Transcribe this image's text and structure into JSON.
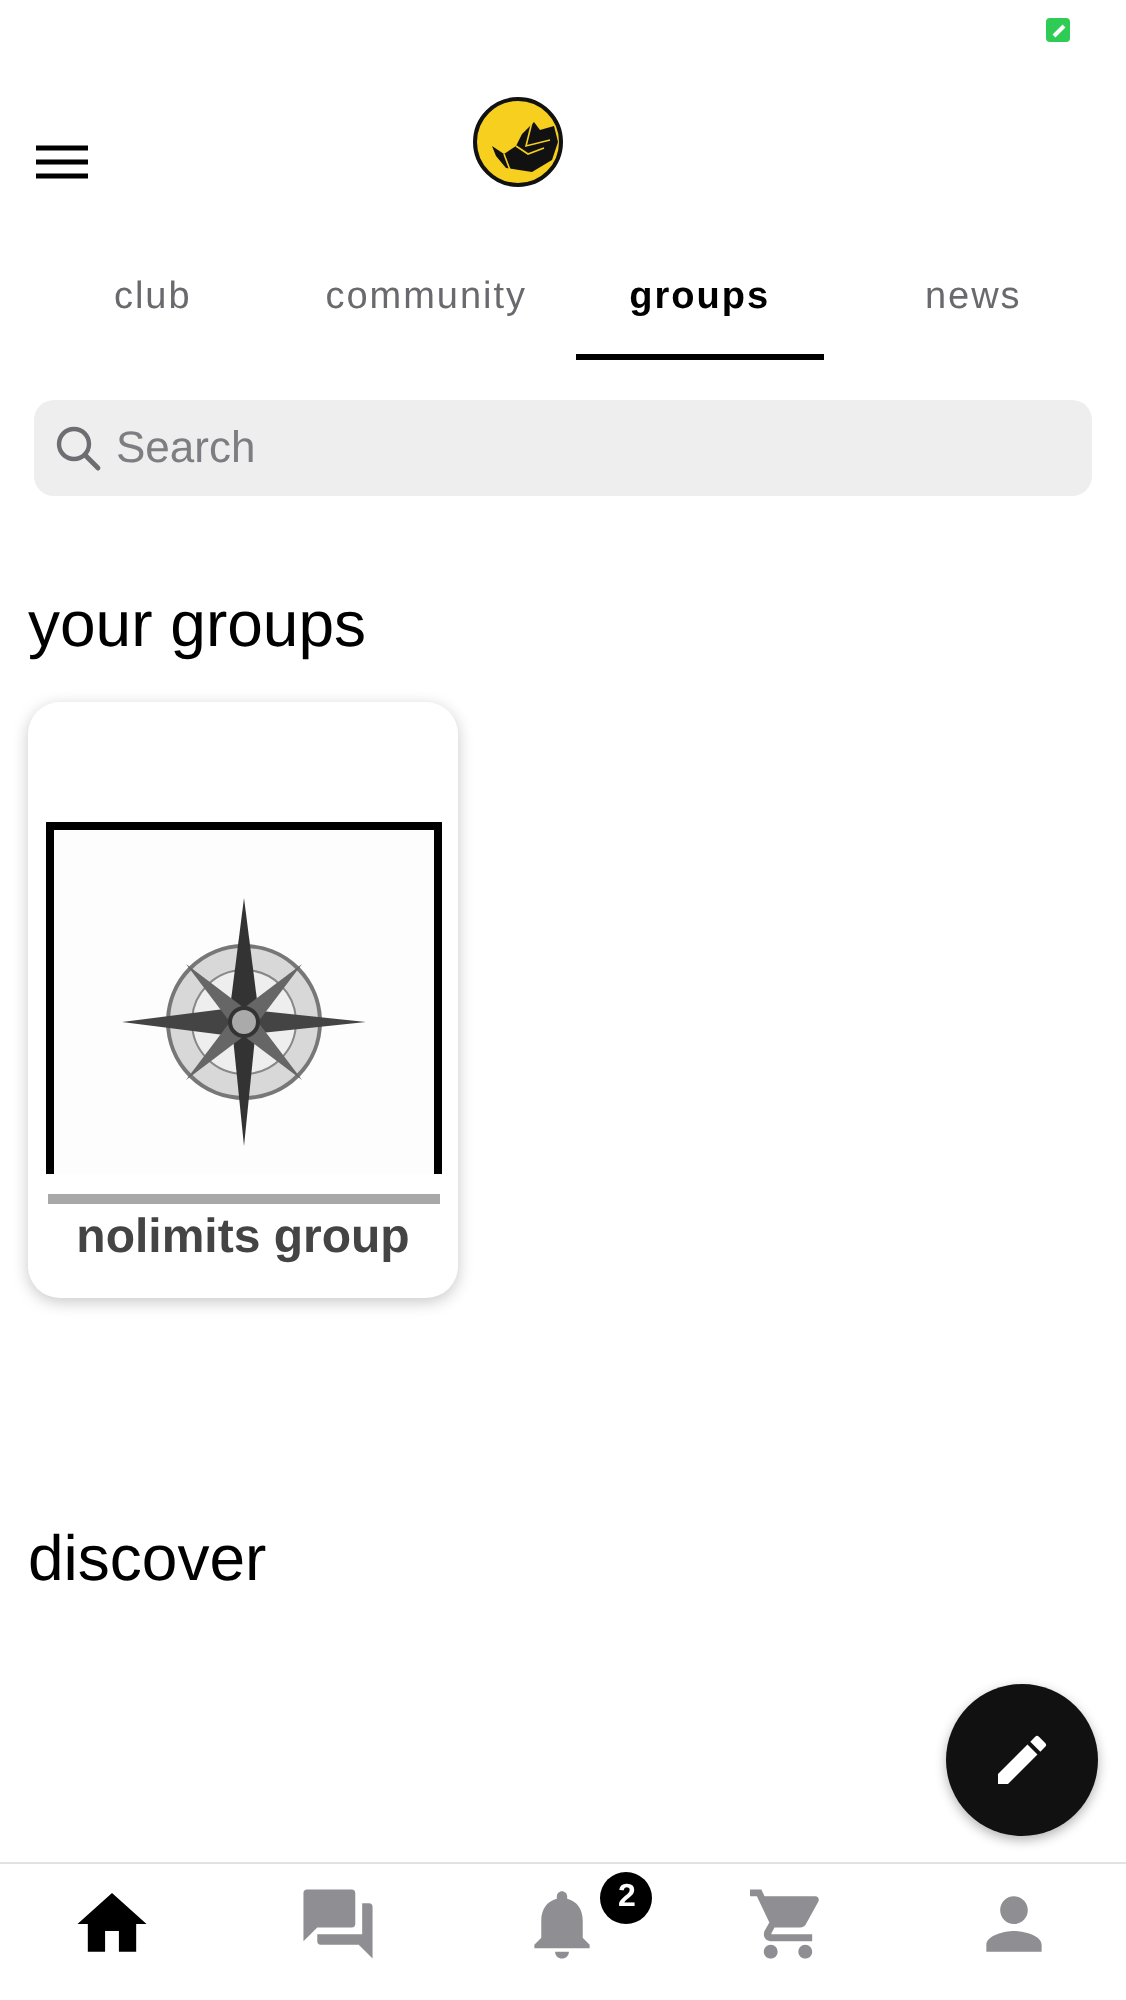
{
  "tabs": [
    {
      "label": "club",
      "selected": false
    },
    {
      "label": "community",
      "selected": false
    },
    {
      "label": "groups",
      "selected": true
    },
    {
      "label": "news",
      "selected": false
    }
  ],
  "search": {
    "placeholder": "Search"
  },
  "your_groups": {
    "title": "your groups",
    "groups": [
      {
        "name": "nolimits group"
      }
    ]
  },
  "discover": {
    "title": "discover"
  },
  "bottom_nav": [
    {
      "kind": "home",
      "selected": true
    },
    {
      "kind": "chat",
      "selected": false
    },
    {
      "kind": "bell",
      "selected": false,
      "badge": "2"
    },
    {
      "kind": "cart",
      "selected": false
    },
    {
      "kind": "person",
      "selected": false
    }
  ]
}
